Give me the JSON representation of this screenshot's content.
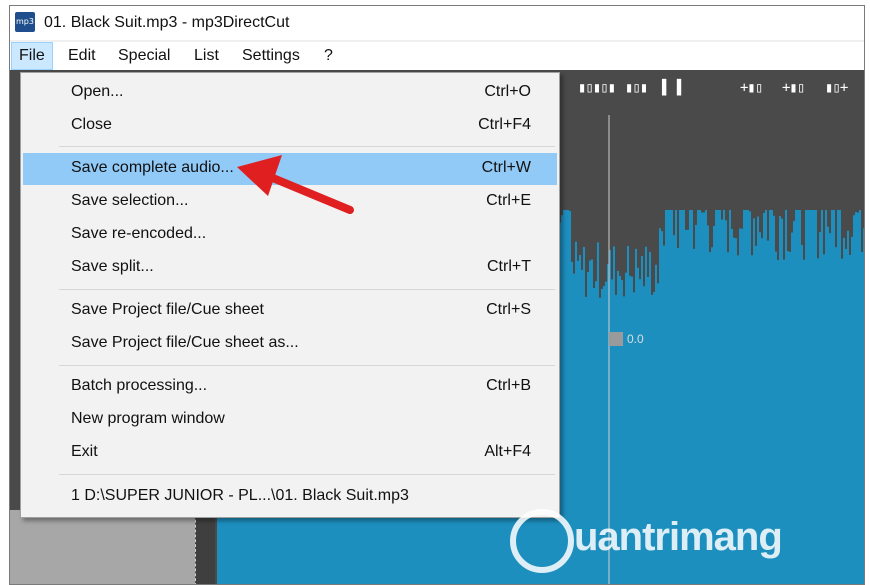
{
  "window": {
    "title": "01. Black Suit.mp3 - mp3DirectCut",
    "app_icon_text": "mp3"
  },
  "menubar": {
    "items": [
      "File",
      "Edit",
      "Special",
      "List",
      "Settings",
      "?"
    ],
    "active": "File"
  },
  "file_menu": {
    "items": [
      {
        "label": "Open...",
        "shortcut": "Ctrl+O"
      },
      {
        "label": "Close",
        "shortcut": "Ctrl+F4"
      },
      {
        "label": "Save complete audio...",
        "shortcut": "Ctrl+W",
        "highlighted": true
      },
      {
        "label": "Save selection...",
        "shortcut": "Ctrl+E"
      },
      {
        "label": "Save re-encoded...",
        "shortcut": ""
      },
      {
        "label": "Save split...",
        "shortcut": "Ctrl+T"
      },
      {
        "label": "Save Project file/Cue sheet",
        "shortcut": "Ctrl+S"
      },
      {
        "label": "Save Project file/Cue sheet as...",
        "shortcut": ""
      },
      {
        "label": "Batch processing...",
        "shortcut": "Ctrl+B"
      },
      {
        "label": "New program window",
        "shortcut": ""
      },
      {
        "label": "Exit",
        "shortcut": "Alt+F4"
      },
      {
        "label": "1 D:\\SUPER JUNIOR - PL...\\01. Black Suit.mp3",
        "shortcut": ""
      }
    ]
  },
  "editor": {
    "marker_value": "0.0",
    "toolbar_icons": [
      "skip-start-icon",
      "prev-icon",
      "pause-icon",
      "mark-in-icon",
      "mark-out-icon",
      "skip-end-icon"
    ]
  },
  "watermark": {
    "text": "uantrimang"
  },
  "colors": {
    "highlight": "#91c9f7",
    "waveform": "#1d8fbf",
    "editor_bg": "#4a4a4a",
    "arrow": "#e02020"
  }
}
